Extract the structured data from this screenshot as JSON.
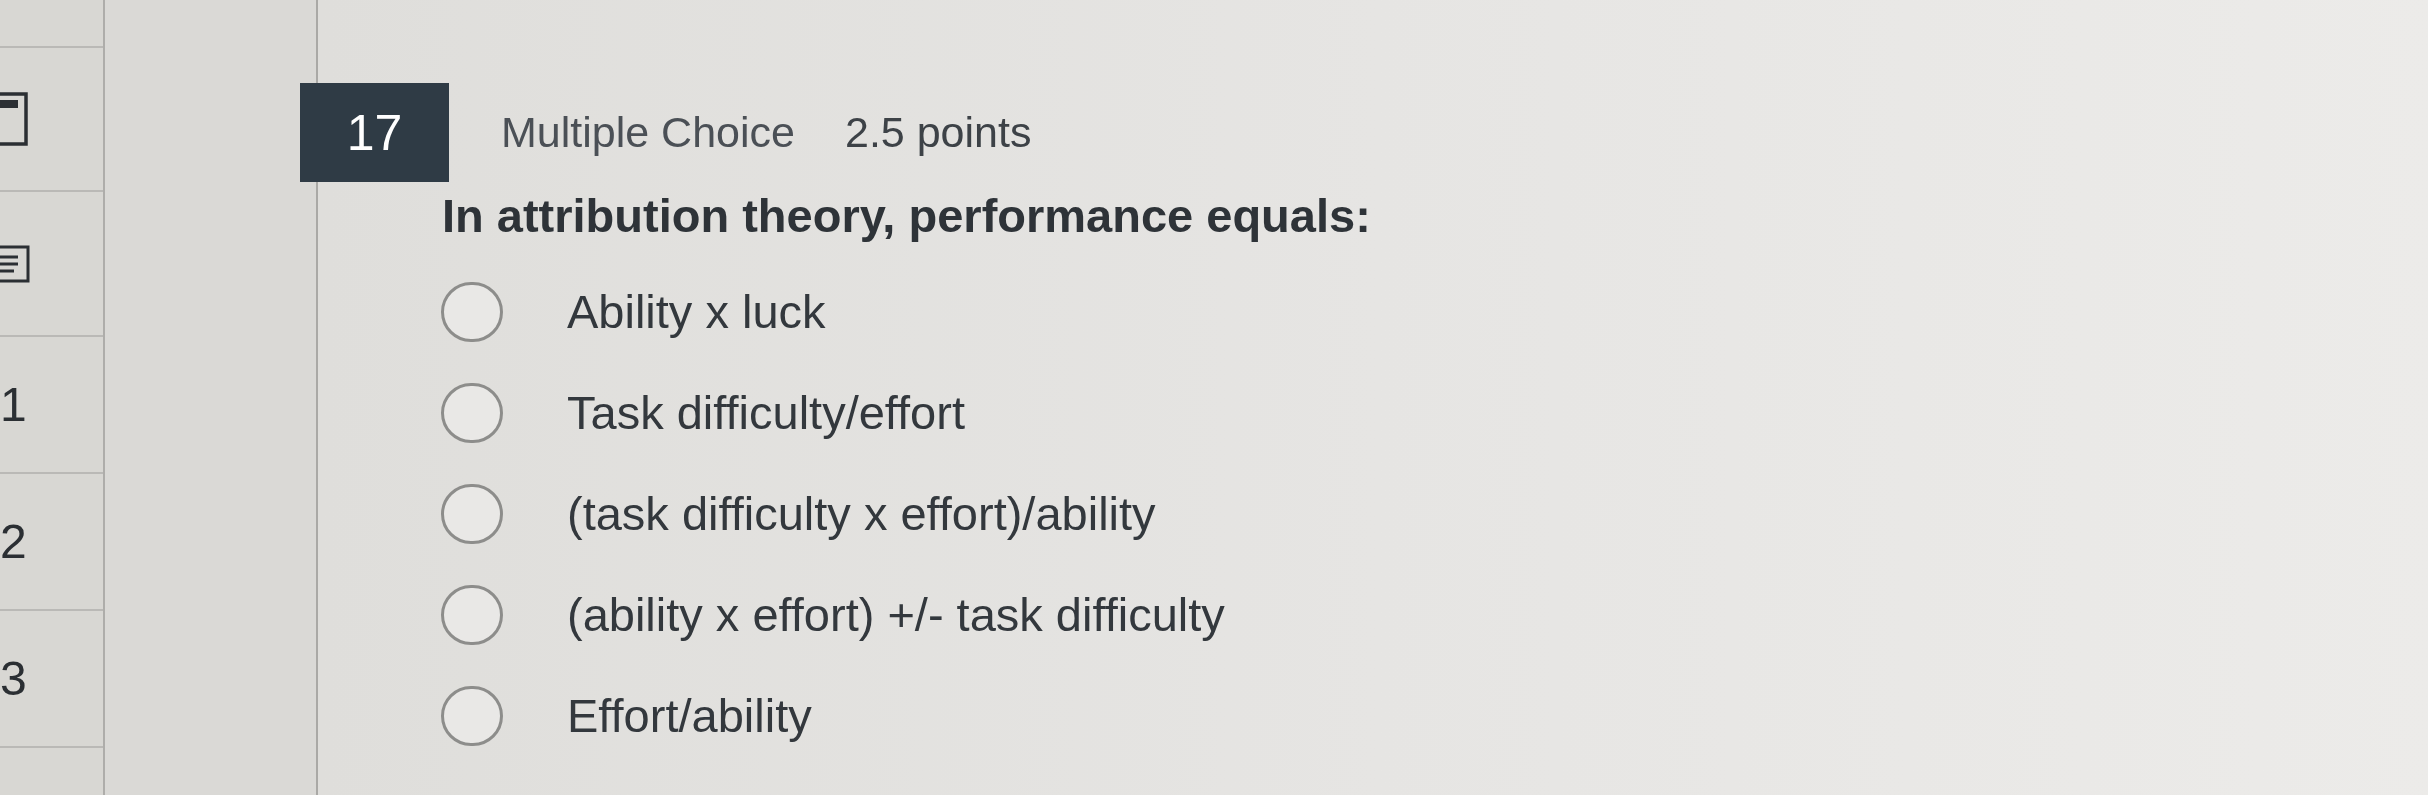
{
  "sidebar": {
    "items": [
      {
        "label": "1"
      },
      {
        "label": "2"
      },
      {
        "label": "3"
      }
    ]
  },
  "question": {
    "number": "17",
    "type": "Multiple Choice",
    "points": "2.5 points",
    "text": "In attribution theory, performance equals:",
    "options": [
      {
        "label": "Ability x luck",
        "selected": false
      },
      {
        "label": "Task difficulty/effort",
        "selected": false
      },
      {
        "label": "(task difficulty x effort)/ability",
        "selected": false
      },
      {
        "label": "(ability x effort) +/- task difficulty",
        "selected": false
      },
      {
        "label": "Effort/ability",
        "selected": false
      }
    ]
  }
}
